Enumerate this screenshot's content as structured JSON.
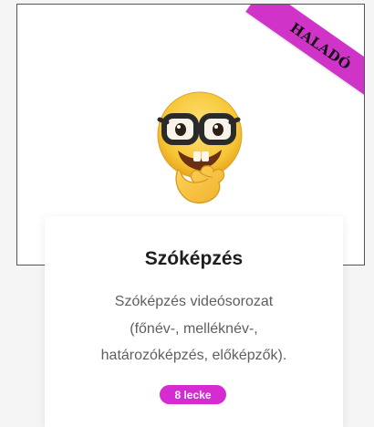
{
  "course": {
    "level_label": "HALADÓ",
    "title": "Szóképzés",
    "description_lines": [
      "Szóképzés videósorozat",
      "(főnév-, melléknév-,",
      "határozóképzés, előképzők)."
    ],
    "lessons_badge": "8 lecke",
    "emoji": "nerd-face-thinking-icon"
  },
  "colors": {
    "ribbon": "#cf33c8",
    "badge": "#d52bd0",
    "title": "#1e1e1e",
    "description": "#5f5f5f"
  }
}
